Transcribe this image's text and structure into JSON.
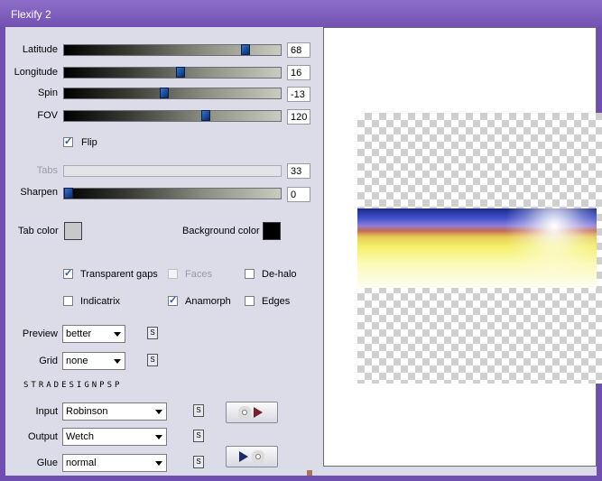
{
  "window": {
    "title": "Flexify 2"
  },
  "sliders": [
    {
      "label": "Latitude",
      "value": "68",
      "fraction": 0.85
    },
    {
      "label": "Longitude",
      "value": "16",
      "fraction": 0.54
    },
    {
      "label": "Spin",
      "value": "-13",
      "fraction": 0.46
    },
    {
      "label": "FOV",
      "value": "120",
      "fraction": 0.66
    }
  ],
  "flip": {
    "label": "Flip",
    "checked": true
  },
  "tabs": {
    "label": "Tabs",
    "value": "33"
  },
  "sharpen": {
    "label": "Sharpen",
    "value": "0",
    "fraction": 0.0
  },
  "colors": {
    "tab_color_label": "Tab color",
    "tab_color": "#c8c8c8",
    "background_color_label": "Background color",
    "background_color": "#000000"
  },
  "options": {
    "transparent_gaps": {
      "label": "Transparent gaps",
      "checked": true
    },
    "faces": {
      "label": "Faces",
      "checked": false
    },
    "de_halo": {
      "label": "De-halo",
      "checked": false
    },
    "indicatrix": {
      "label": "Indicatrix",
      "checked": false
    },
    "anamorph": {
      "label": "Anamorph",
      "checked": true
    },
    "edges": {
      "label": "Edges",
      "checked": false
    }
  },
  "preview": {
    "label": "Preview",
    "value": "better"
  },
  "grid": {
    "label": "Grid",
    "value": "none"
  },
  "brand": "STRADESIGNPSP",
  "input": {
    "label": "Input",
    "value": "Robinson"
  },
  "output": {
    "label": "Output",
    "value": "Wetch"
  },
  "glue": {
    "label": "Glue",
    "value": "normal"
  },
  "s_button_label": "S"
}
